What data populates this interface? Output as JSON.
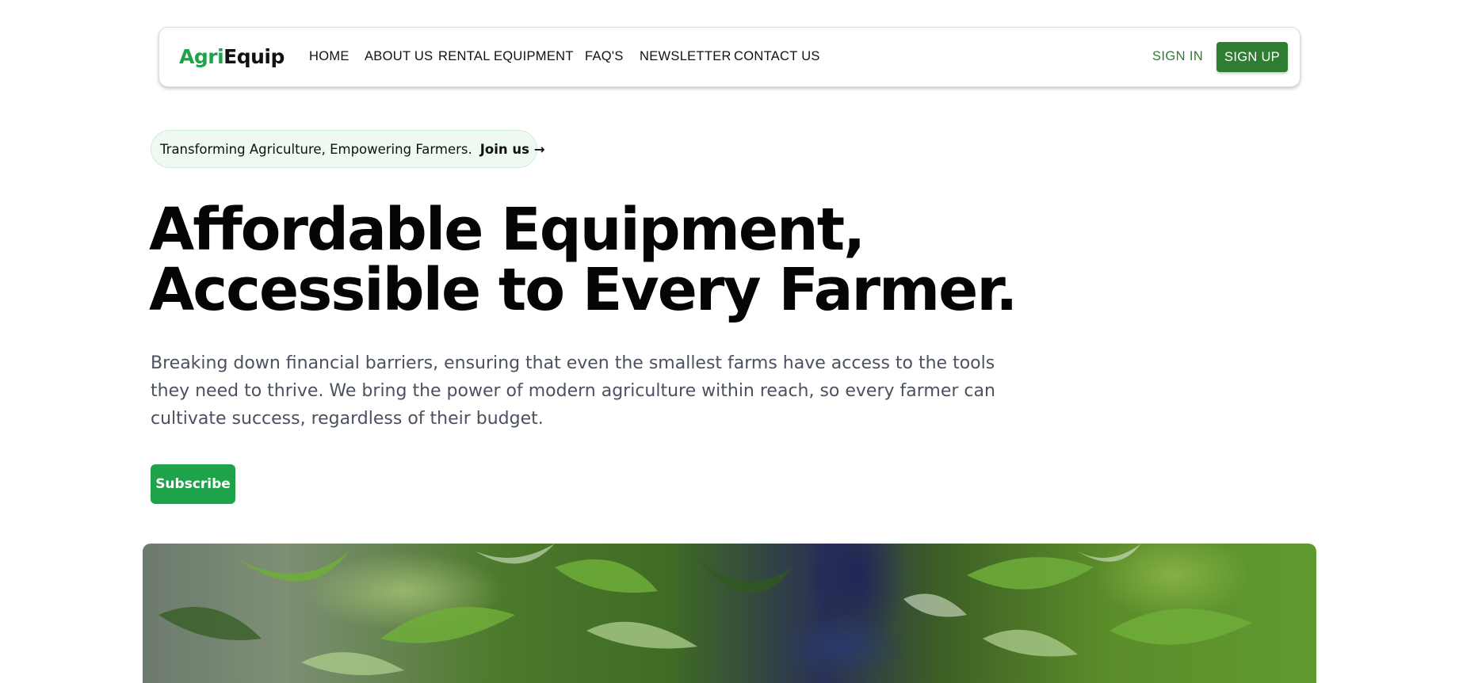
{
  "brand": {
    "part1": "Agri",
    "part2": "Equip"
  },
  "nav": {
    "items": [
      {
        "label": "HOME"
      },
      {
        "label": "ABOUT US"
      },
      {
        "label": "RENTAL EQUIPMENT"
      },
      {
        "label": "FAQ'S"
      },
      {
        "label": "NEWSLETTER"
      },
      {
        "label": "CONTACT US"
      }
    ],
    "sign_in": "SIGN IN",
    "sign_up": "SIGN UP"
  },
  "announcement": {
    "text": "Transforming Agriculture, Empowering Farmers.",
    "link": "Join us →"
  },
  "hero": {
    "headline_line1": "Affordable Equipment,",
    "headline_line2": "Accessible to Every Farmer.",
    "description_line1": "Breaking down financial barriers, ensuring that even the smallest farms have access to the tools",
    "description_line2": "they need to thrive. We bring the power of modern agriculture within reach, so every farmer can",
    "description_line3": "cultivate success, regardless of their budget.",
    "cta": "Subscribe"
  },
  "colors": {
    "brand_green": "#1ea34b",
    "nav_green": "#2e7d32",
    "text_dark": "#0b0b0b",
    "text_muted": "#4a5160"
  }
}
